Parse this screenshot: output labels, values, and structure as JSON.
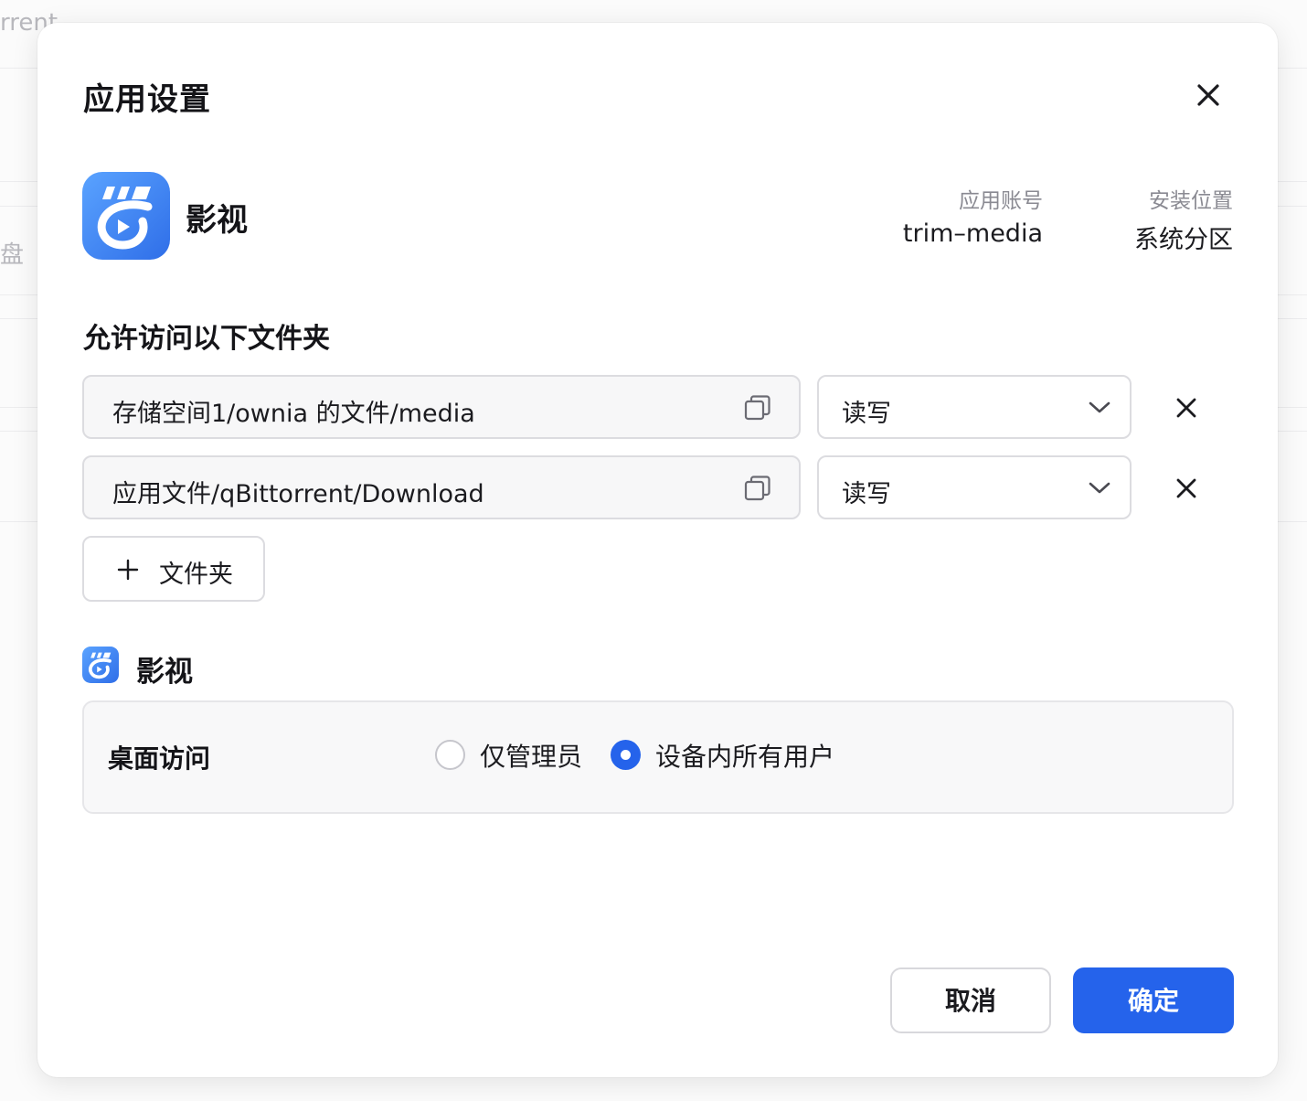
{
  "background": {
    "text_top": "rrent",
    "text_left": "盘"
  },
  "dialog": {
    "title": "应用设置",
    "close_icon": "close-icon"
  },
  "app": {
    "name": "影视",
    "icon": "video-app-icon",
    "icon_color": "#3a82f0",
    "account_label": "应用账号",
    "account_value": "trim–media",
    "location_label": "安装位置",
    "location_value": "系统分区"
  },
  "folders": {
    "section_title": "允许访问以下文件夹",
    "items": [
      {
        "path": "存储空间1/ownia 的文件/media",
        "permission": "读写"
      },
      {
        "path": "应用文件/qBittorrent/Download",
        "permission": "读写"
      }
    ],
    "add_label": "文件夹"
  },
  "access": {
    "app_name": "影视",
    "label": "桌面访问",
    "options": [
      "仅管理员",
      "设备内所有用户"
    ],
    "selected": "设备内所有用户"
  },
  "buttons": {
    "cancel": "取消",
    "confirm": "确定"
  },
  "colors": {
    "primary": "#2563eb"
  }
}
